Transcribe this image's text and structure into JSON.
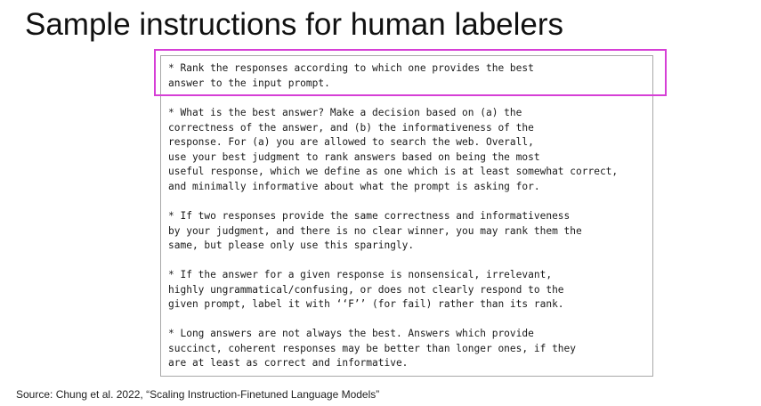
{
  "slide": {
    "title": "Sample instructions for human labelers",
    "source": "Source: Chung et al. 2022, “Scaling Instruction-Finetuned Language Models”"
  },
  "document": {
    "paragraphs": [
      "* Rank the responses according to which one provides the best\nanswer to the input prompt.",
      "* What is the best answer? Make a decision based on (a) the\ncorrectness of the answer, and (b) the informativeness of the\nresponse. For (a) you are allowed to search the web. Overall,\nuse your best judgment to rank answers based on being the most\nuseful response, which we define as one which is at least somewhat correct,\nand minimally informative about what the prompt is asking for.",
      "* If two responses provide the same correctness and informativeness\nby your judgment, and there is no clear winner, you may rank them the\nsame, but please only use this sparingly.",
      "* If the answer for a given response is nonsensical, irrelevant,\nhighly ungrammatical/confusing, or does not clearly respond to the\ngiven prompt, label it with ‘‘F’’ (for fail) rather than its rank.",
      "* Long answers are not always the best. Answers which provide\nsuccinct, coherent responses may be better than longer ones, if they\nare at least as correct and informative."
    ]
  },
  "colors": {
    "highlight_border": "#d63fd6",
    "doc_border": "#a8a8a8",
    "text": "#1a1a1a"
  }
}
